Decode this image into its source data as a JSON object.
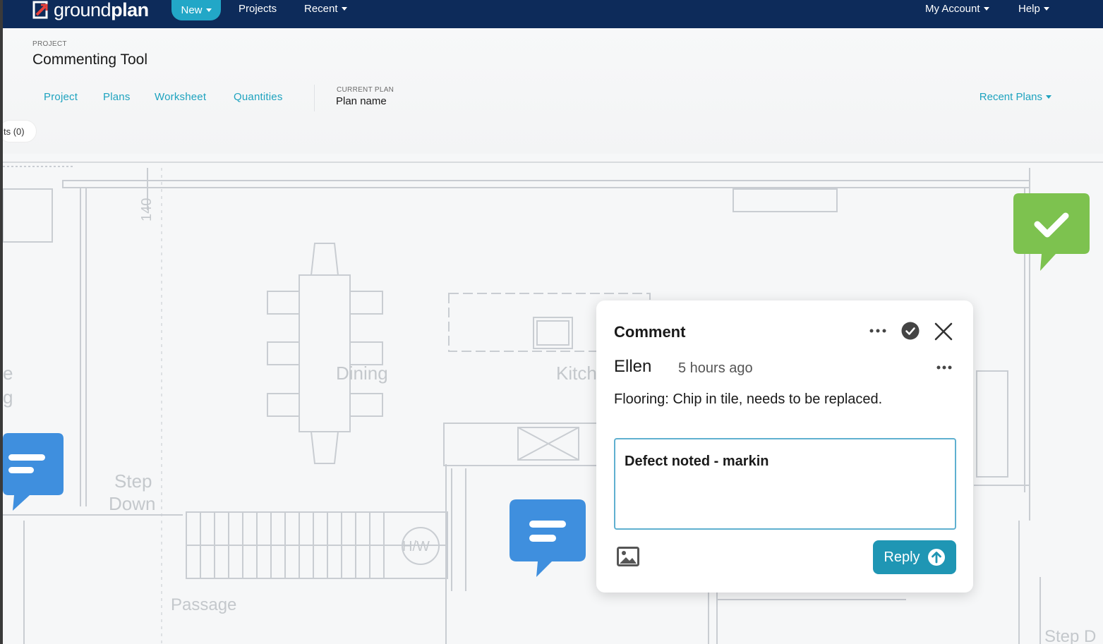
{
  "nav": {
    "logo_text_light": "ground",
    "logo_text_bold": "plan",
    "new_label": "New",
    "projects_label": "Projects",
    "recent_label": "Recent",
    "account_label": "My Account",
    "help_label": "Help"
  },
  "header": {
    "project_eyebrow": "PROJECT",
    "project_title": "Commenting Tool",
    "tabs": [
      {
        "label": "Project"
      },
      {
        "label": "Plans"
      },
      {
        "label": "Worksheet"
      },
      {
        "label": "Quantities"
      }
    ],
    "current_plan_eyebrow": "CURRENT PLAN",
    "current_plan_name": "Plan name",
    "recent_plans_label": "Recent Plans",
    "comments_count_label": "ts (0)"
  },
  "plan": {
    "room_labels": {
      "dining": "Dining",
      "kitchen": "Kitch",
      "step_down_1": "Step",
      "step_down_2": "Down",
      "passage": "Passage",
      "hw": "H/W",
      "step_right": "Step D",
      "dimension": "140",
      "left_e": "e",
      "left_g": "g"
    }
  },
  "comment": {
    "title": "Comment",
    "author": "Ellen",
    "time_ago": "5 hours ago",
    "body": "Flooring: Chip in tile, needs to be replaced.",
    "reply_value": "Defect noted - markin",
    "reply_button": "Reply"
  },
  "icons": {
    "more": "more-icon",
    "resolve": "check-circle-icon",
    "close": "close-icon",
    "image": "image-icon",
    "send": "arrow-up-circle-icon"
  },
  "colors": {
    "nav_bg": "#0d2b5a",
    "accent": "#22a7c7",
    "marker_blue": "#3f8fde",
    "marker_green": "#7dc24f",
    "reply_button": "#1f96b4"
  }
}
